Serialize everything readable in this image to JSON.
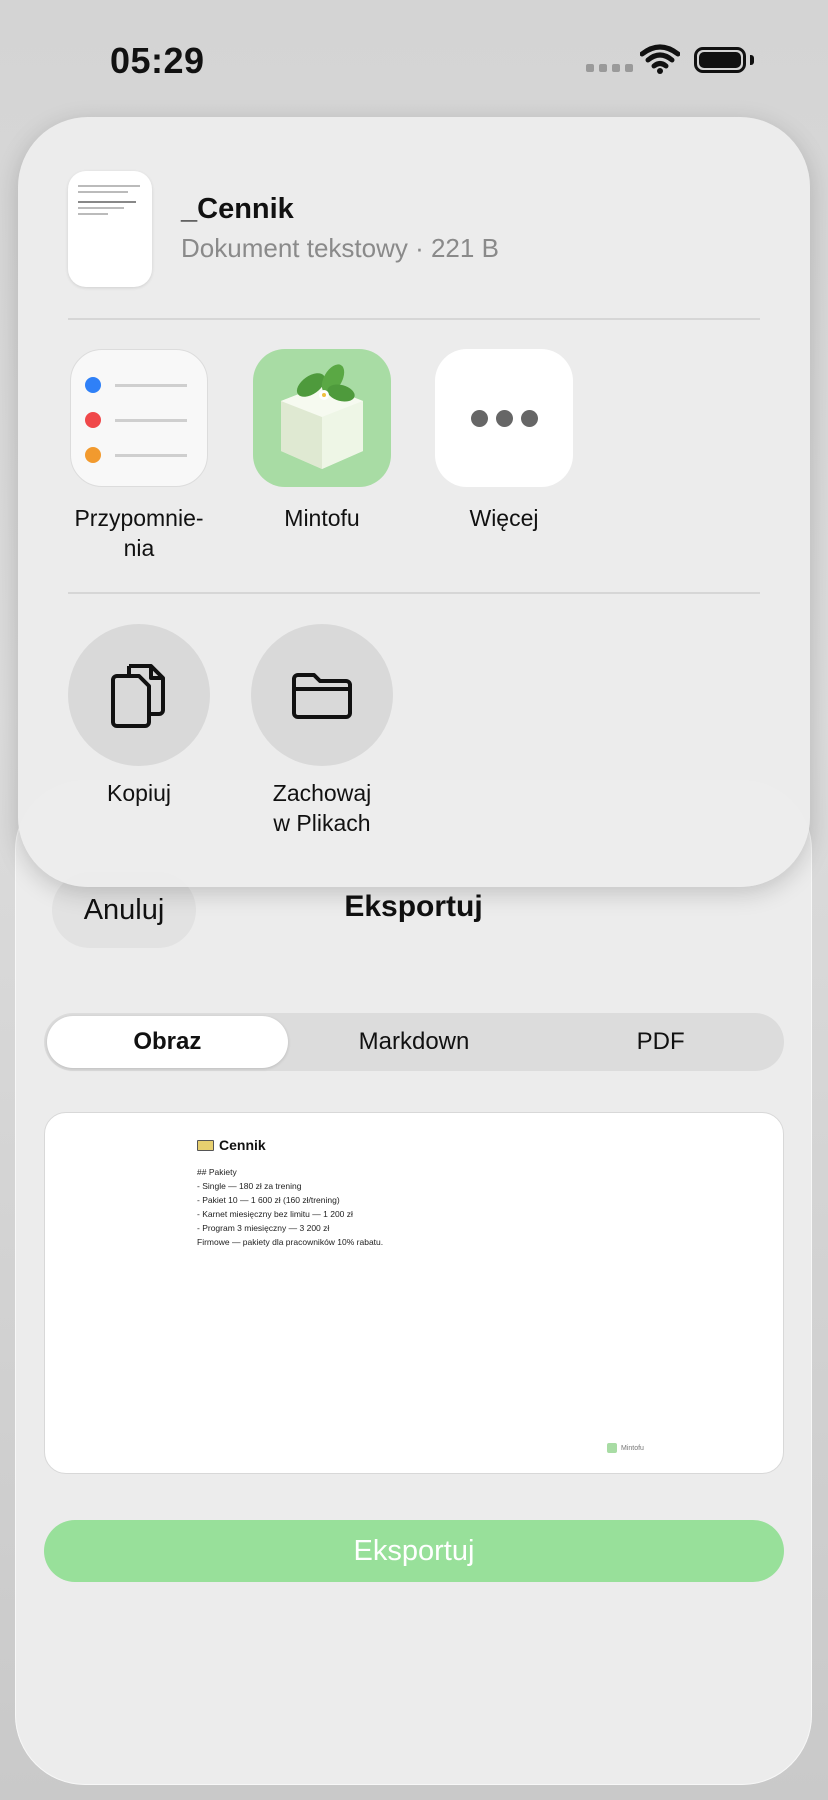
{
  "status_bar": {
    "time": "05:29"
  },
  "share_sheet": {
    "document": {
      "name": "_Cennik",
      "meta": "Dokument tekstowy · 221 B"
    },
    "apps": [
      {
        "label": "Przypomnie-\nnia",
        "icon": "reminders-icon"
      },
      {
        "label": "Mintofu",
        "icon": "mintofu-app-icon"
      },
      {
        "label": "Więcej",
        "icon": "more-icon"
      }
    ],
    "actions": [
      {
        "label": "Kopiuj",
        "icon": "copy-icon"
      },
      {
        "label": "Zachowaj\nw Plikach",
        "icon": "folder-icon"
      }
    ]
  },
  "export_sheet": {
    "cancel_label": "Anuluj",
    "title": "Eksportuj",
    "tabs": [
      {
        "label": "Obraz",
        "active": true
      },
      {
        "label": "Markdown",
        "active": false
      },
      {
        "label": "PDF",
        "active": false
      }
    ],
    "preview": {
      "title": "Cennik",
      "lines": [
        "## Pakiety",
        "- Single — 180 zł za trening",
        "- Pakiet 10 — 1 600 zł (160 zł/trening)",
        "- Karnet miesięczny bez limitu — 1 200 zł",
        "- Program 3 miesięczny — 3 200 zł",
        "Firmowe — pakiety dla pracowników 10% rabatu."
      ],
      "footer": "Mintofu"
    },
    "export_label": "Eksportuj"
  },
  "colors": {
    "accent_green": "#98e09a",
    "reminder_blue": "#2f80f7",
    "reminder_red": "#f0484a",
    "reminder_orange": "#f29a2e"
  }
}
